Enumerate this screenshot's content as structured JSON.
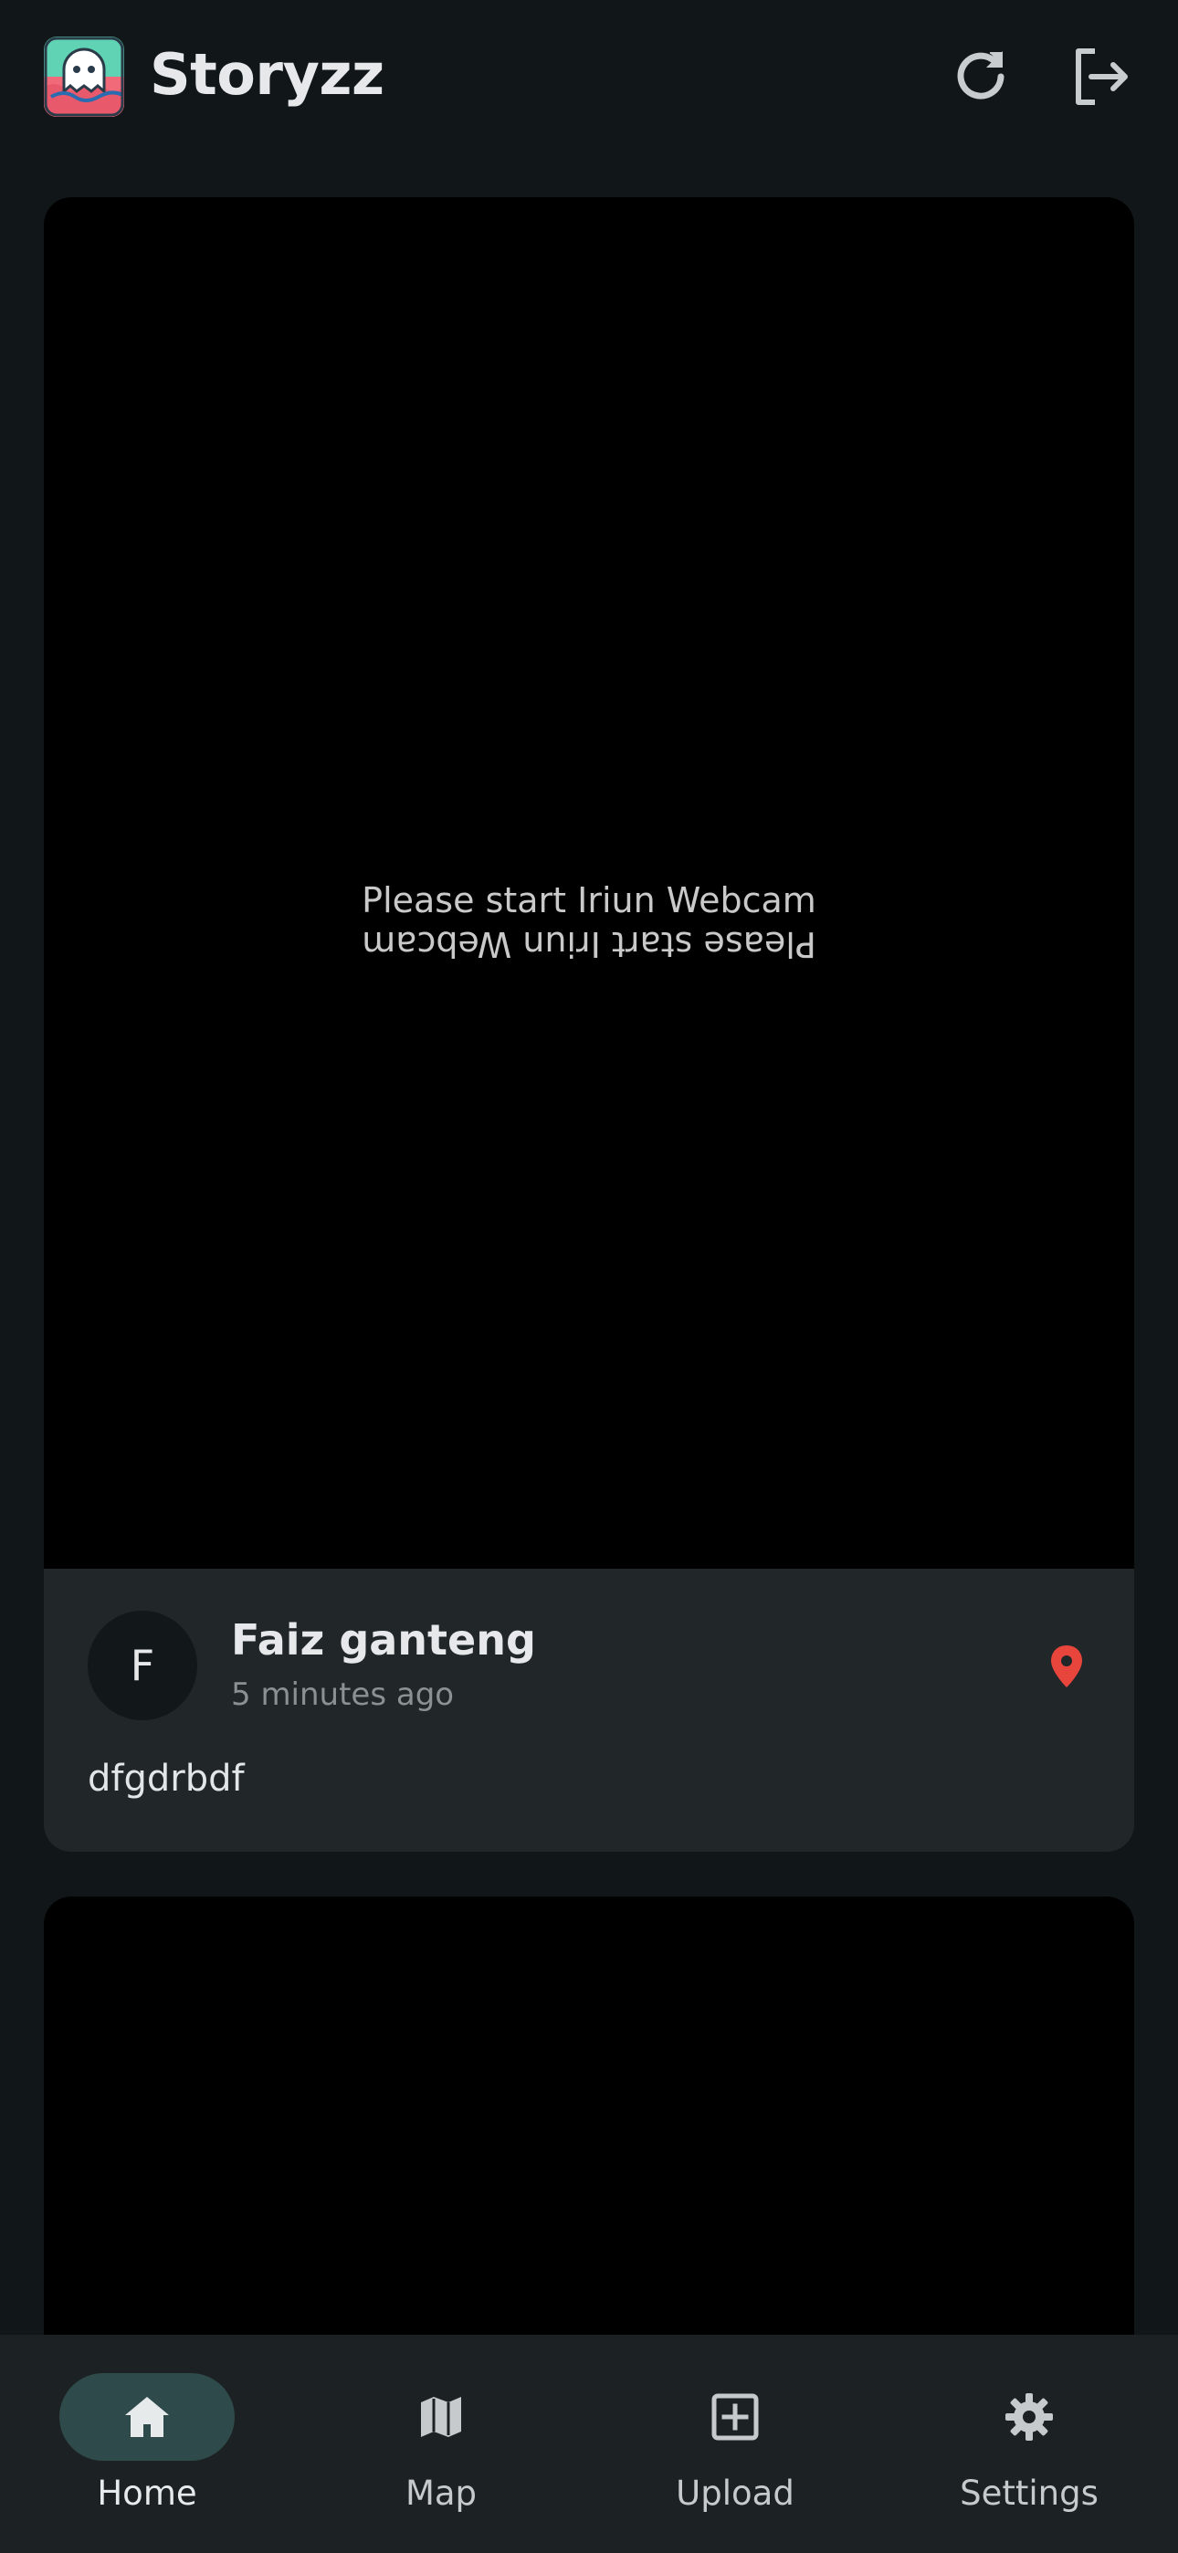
{
  "app": {
    "title": "Storyzz",
    "logo_icon": "storyzz-logo-icon",
    "actions": {
      "refresh_icon": "refresh-icon",
      "logout_icon": "logout-icon"
    }
  },
  "stories": [
    {
      "photo_text_line1": "Please start Iriun Webcam",
      "photo_text_line2": "Please start Iriun Webcam",
      "avatar_initial": "F",
      "author": "Faiz ganteng",
      "time": "5 minutes ago",
      "location_icon": "location-pin-icon",
      "description": "dfgdrbdf"
    },
    {
      "photo_text_line1": "",
      "author": "",
      "description": ""
    }
  ],
  "nav": {
    "items": [
      {
        "label": "Home",
        "icon": "home-icon",
        "active": true
      },
      {
        "label": "Map",
        "icon": "map-icon",
        "active": false
      },
      {
        "label": "Upload",
        "icon": "add-box-icon",
        "active": false
      },
      {
        "label": "Settings",
        "icon": "settings-icon",
        "active": false
      }
    ]
  },
  "colors": {
    "background": "#111618",
    "card": "#212628",
    "navbar": "#1c2123",
    "active_pill": "#2f4a4a",
    "location_pin": "#e8453c"
  }
}
